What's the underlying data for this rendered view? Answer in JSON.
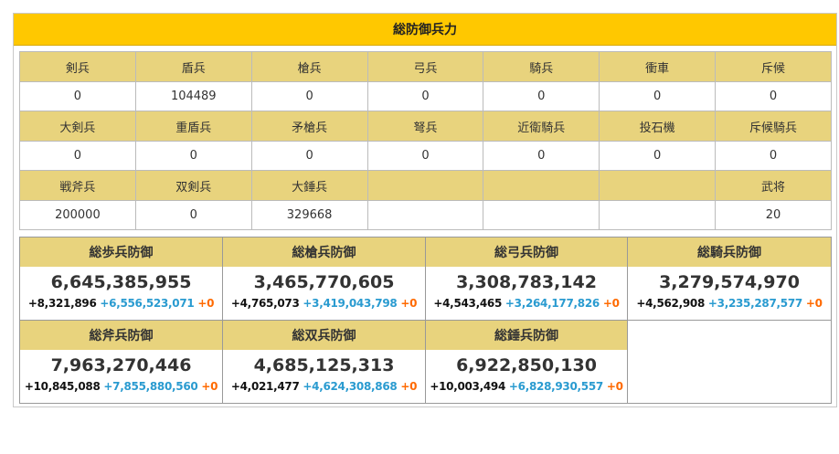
{
  "title": "総防御兵力",
  "units": {
    "rows": [
      {
        "headers": [
          "剣兵",
          "盾兵",
          "槍兵",
          "弓兵",
          "騎兵",
          "衝車",
          "斥候"
        ],
        "values": [
          "0",
          "104489",
          "0",
          "0",
          "0",
          "0",
          "0"
        ]
      },
      {
        "headers": [
          "大剣兵",
          "重盾兵",
          "矛槍兵",
          "弩兵",
          "近衛騎兵",
          "投石機",
          "斥候騎兵"
        ],
        "values": [
          "0",
          "0",
          "0",
          "0",
          "0",
          "0",
          "0"
        ]
      },
      {
        "headers": [
          "戦斧兵",
          "双剣兵",
          "大錘兵",
          "",
          "",
          "",
          "武将"
        ],
        "values": [
          "200000",
          "0",
          "329668",
          "",
          "",
          "",
          "20"
        ]
      }
    ]
  },
  "totals": [
    {
      "label": "総歩兵防御",
      "total": "6,645,385,955",
      "base": "+8,321,896",
      "bonus": "+6,556,523,071",
      "extra": "+0"
    },
    {
      "label": "総槍兵防御",
      "total": "3,465,770,605",
      "base": "+4,765,073",
      "bonus": "+3,419,043,798",
      "extra": "+0"
    },
    {
      "label": "総弓兵防御",
      "total": "3,308,783,142",
      "base": "+4,543,465",
      "bonus": "+3,264,177,826",
      "extra": "+0"
    },
    {
      "label": "総騎兵防御",
      "total": "3,279,574,970",
      "base": "+4,562,908",
      "bonus": "+3,235,287,577",
      "extra": "+0"
    },
    {
      "label": "総斧兵防御",
      "total": "7,963,270,446",
      "base": "+10,845,088",
      "bonus": "+7,855,880,560",
      "extra": "+0"
    },
    {
      "label": "総双兵防御",
      "total": "4,685,125,313",
      "base": "+4,021,477",
      "bonus": "+4,624,308,868",
      "extra": "+0"
    },
    {
      "label": "総錘兵防御",
      "total": "6,922,850,130",
      "base": "+10,003,494",
      "bonus": "+6,828,930,557",
      "extra": "+0"
    }
  ],
  "colors": {
    "title_bg": "#ffc800",
    "header_bg": "#e8d37d",
    "bonus": "#2a9bd0",
    "extra": "#ff6a00"
  }
}
